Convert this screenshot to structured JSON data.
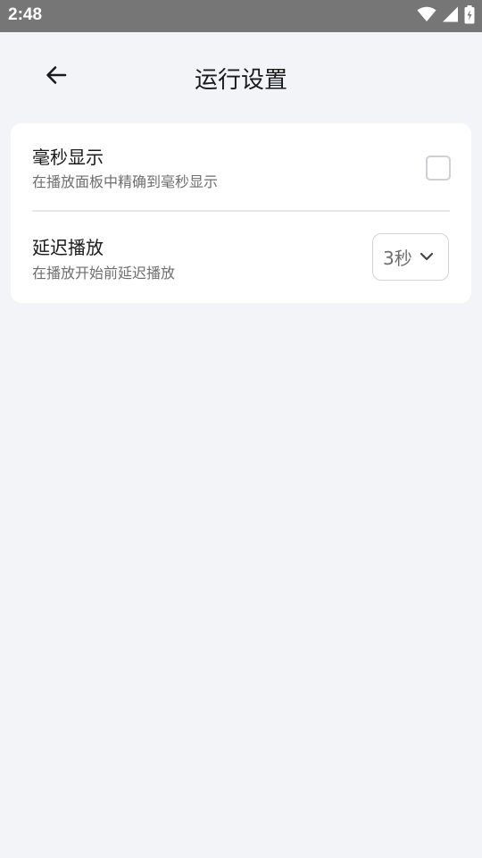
{
  "status_bar": {
    "time": "2:48",
    "icons": [
      "wifi-icon",
      "cellular-signal-icon",
      "battery-charging-icon"
    ]
  },
  "header": {
    "title": "运行设置",
    "back_icon": "arrow-left-icon"
  },
  "settings": {
    "millisecond_display": {
      "title": "毫秒显示",
      "description": "在播放面板中精确到毫秒显示",
      "checked": false
    },
    "delayed_playback": {
      "title": "延迟播放",
      "description": "在播放开始前延迟播放",
      "selected_value": "3秒"
    }
  },
  "colors": {
    "background": "#f3f4f8",
    "status_bar": "#767676",
    "card": "#ffffff",
    "primary_text": "#1a1a1a",
    "secondary_text": "#6e6e6e"
  }
}
